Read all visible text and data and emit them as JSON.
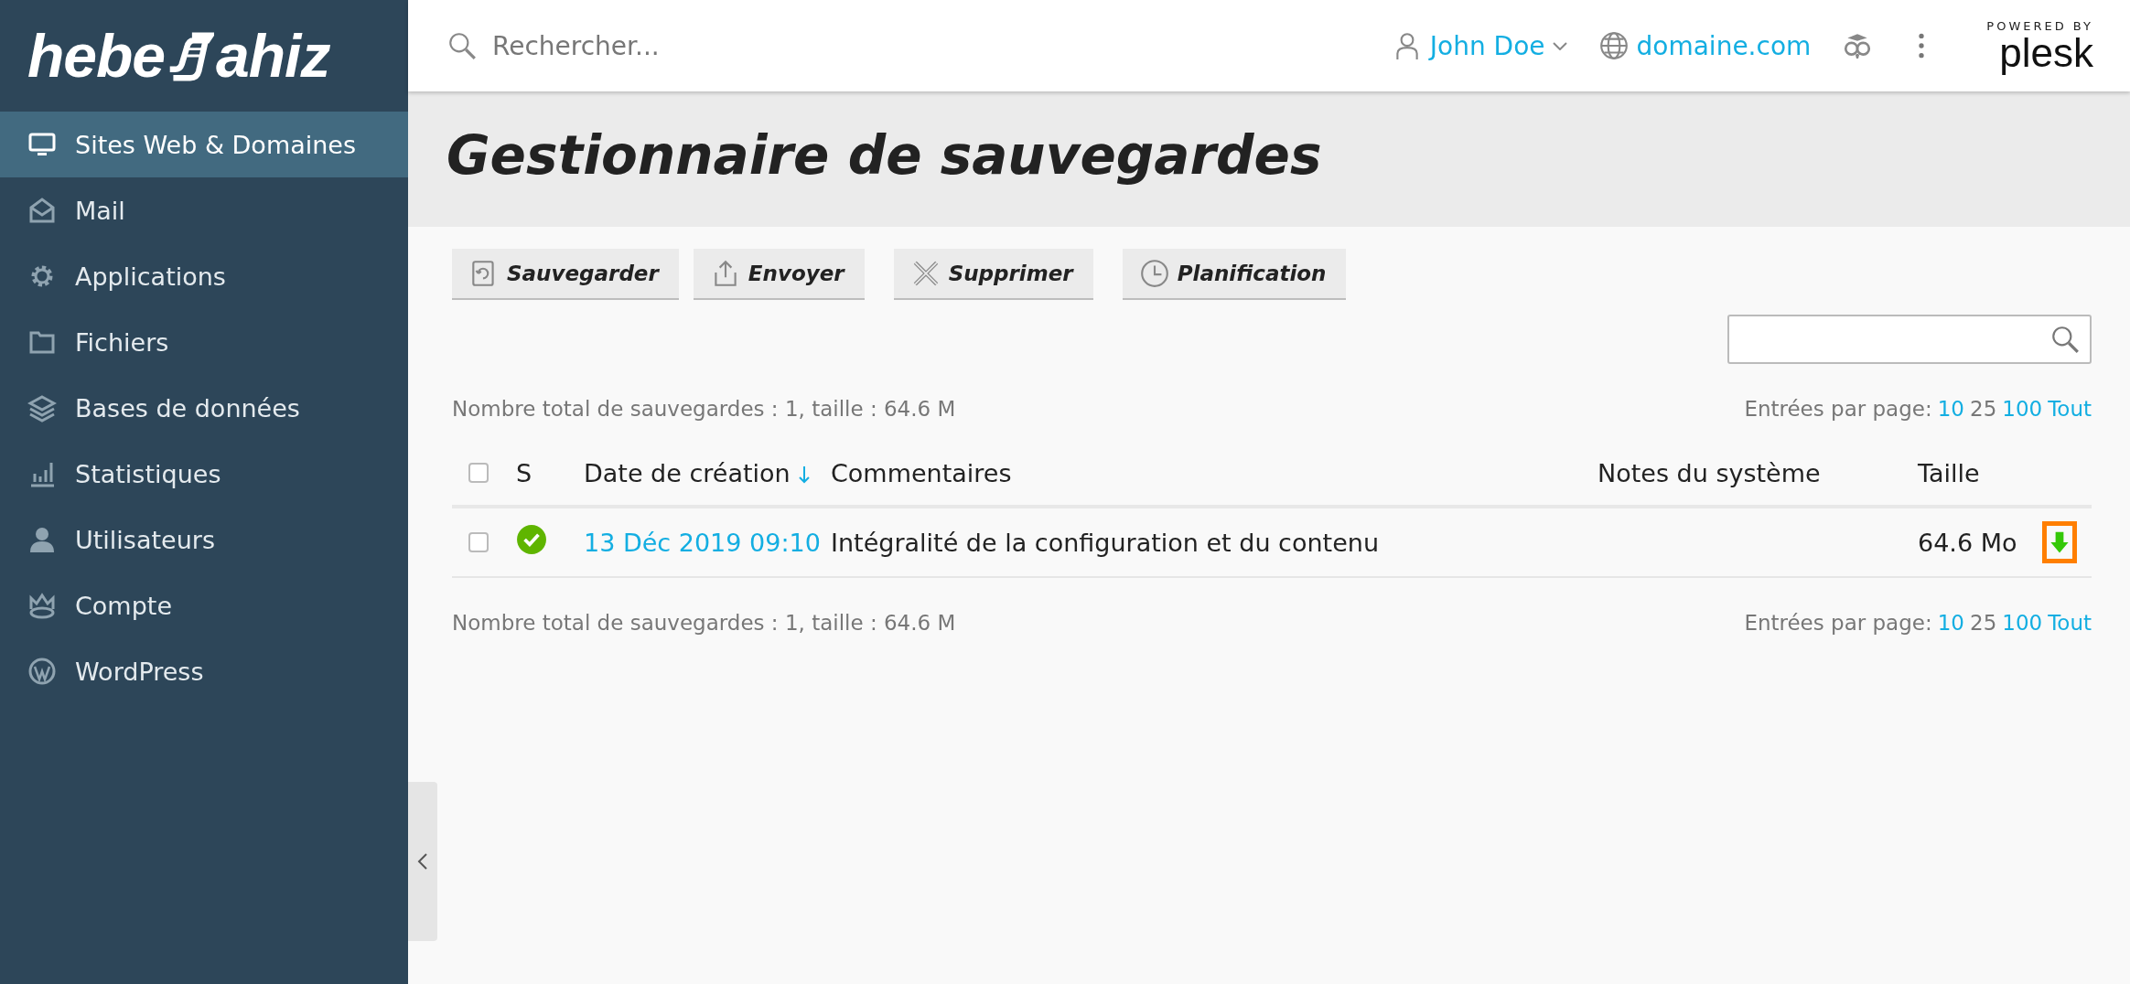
{
  "logo": {
    "left": "hebe",
    "right": "ahiz"
  },
  "sidebar": {
    "items": [
      {
        "label": "Sites Web & Domaines",
        "selected": true
      },
      {
        "label": "Mail",
        "selected": false
      },
      {
        "label": "Applications",
        "selected": false
      },
      {
        "label": "Fichiers",
        "selected": false
      },
      {
        "label": "Bases de données",
        "selected": false
      },
      {
        "label": "Statistiques",
        "selected": false
      },
      {
        "label": "Utilisateurs",
        "selected": false
      },
      {
        "label": "Compte",
        "selected": false
      },
      {
        "label": "WordPress",
        "selected": false
      }
    ]
  },
  "header": {
    "search": {
      "placeholder": "Rechercher..."
    },
    "user": "John Doe",
    "domain": "domaine.com",
    "powered_by": "POWERED BY",
    "brand": "plesk"
  },
  "page": {
    "title": "Gestionnaire de sauvegardes"
  },
  "toolbar": [
    {
      "label": "Sauvegarder"
    },
    {
      "label": "Envoyer"
    },
    {
      "label": "Supprimer"
    },
    {
      "label": "Planification"
    }
  ],
  "summary_top": "Nombre total de sauvegardes : 1, taille : 64.6 M",
  "pagination_top": {
    "label": "Entrées par page:",
    "options": [
      {
        "label": "10",
        "selected": false
      },
      {
        "label": "25",
        "selected": true
      },
      {
        "label": "100",
        "selected": false
      },
      {
        "label": "Tout",
        "selected": false
      }
    ]
  },
  "table": {
    "columns": [
      {
        "label": "S"
      },
      {
        "label": "Date de création",
        "sorted": true
      },
      {
        "label": "Commentaires"
      },
      {
        "label": "Notes du système"
      },
      {
        "label": "Taille"
      }
    ],
    "header_checked": false,
    "rows": [
      {
        "checked": false,
        "success": true,
        "date": "13 Déc 2019 09:10",
        "comment": "Intégralité de la configuration et du contenu",
        "size": "64.6 Mo",
        "download_highlighted": true
      }
    ]
  },
  "summary_bottom": "Nombre total de sauvegardes : 1, taille : 64.6 M",
  "pagination_bottom": {
    "label": "Entrées par page:",
    "options": [
      {
        "label": "10",
        "selected": false
      },
      {
        "label": "25",
        "selected": true
      },
      {
        "label": "100",
        "selected": false
      },
      {
        "label": "Tout",
        "selected": false
      }
    ]
  }
}
